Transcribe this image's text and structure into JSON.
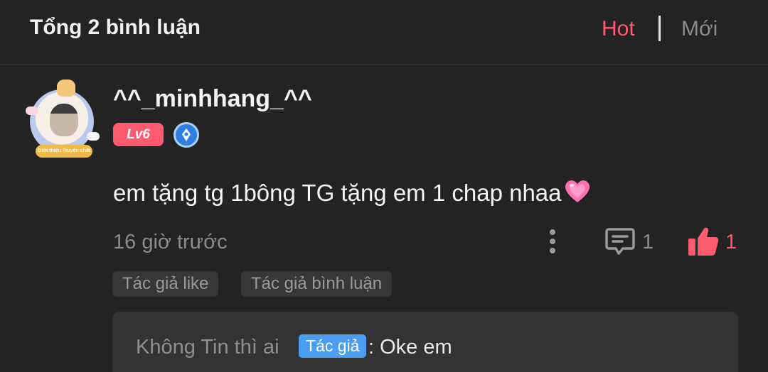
{
  "header": {
    "title": "Tổng 2 bình luận",
    "sort_hot": "Hot",
    "sort_new": "Mới"
  },
  "comment": {
    "avatar_banner": "Giới thiệu Truyện chất",
    "username": "^^_minhhang_^^",
    "level": "Lv6",
    "text": "em tặng tg 1bông TG tặng em 1 chap nhaa",
    "emoji": "pink-heart-icon",
    "timestamp": "16 giờ trước",
    "reply_count": "1",
    "like_count": "1",
    "tags": [
      "Tác giả like",
      "Tác giả bình luận"
    ]
  },
  "reply": {
    "name": "Không Tin thì ai",
    "badge": "Tác giả",
    "text": ": Oke em"
  },
  "colors": {
    "accent": "#ff5a6e",
    "author_badge": "#4b9ef2",
    "background": "#232323"
  }
}
